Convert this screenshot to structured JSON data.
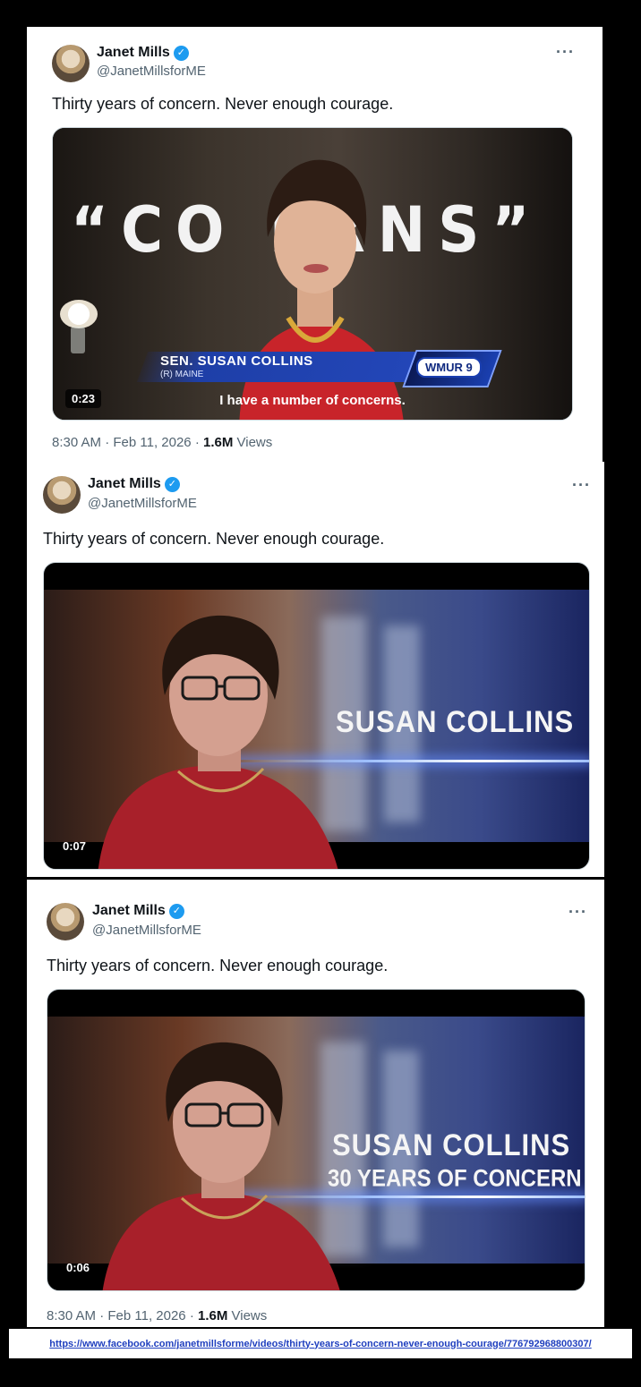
{
  "tweets": [
    {
      "author": "Janet Mills",
      "handle": "@JanetMillsforME",
      "text": "Thirty years of concern. Never enough courage.",
      "video": {
        "duration": "0:23",
        "overlay_word": "“CO   ERNS”",
        "lower_third_name": "SEN. SUSAN COLLINS",
        "lower_third_sub": "(R) MAINE",
        "station_logo": "WMUR 9",
        "caption": "I have a number of concerns."
      },
      "meta": {
        "time_date": "8:30 AM · Feb 11, 2026 · ",
        "views_count": "1.6M",
        "views_label": " Views"
      }
    },
    {
      "author": "Janet Mills",
      "handle": "@JanetMillsforME",
      "text": "Thirty years of concern. Never enough courage.",
      "video": {
        "duration": "0:07",
        "overlay_name": "SUSAN COLLINS"
      }
    },
    {
      "author": "Janet Mills",
      "handle": "@JanetMillsforME",
      "text": "Thirty years of concern. Never enough courage.",
      "video": {
        "duration": "0:06",
        "overlay_name": "SUSAN COLLINS",
        "overlay_sub": "30 YEARS OF CONCERN"
      },
      "meta": {
        "time_date": "8:30 AM · Feb 11, 2026 · ",
        "views_count": "1.6M",
        "views_label": " Views"
      }
    }
  ],
  "icons": {
    "verified": "verified-badge-icon",
    "more": "more-icon"
  },
  "more_glyph": "···",
  "verified_glyph": "✓",
  "source_url": "https://www.facebook.com/janetmillsforme/videos/thirty-years-of-concern-never-enough-courage/776792968800307/",
  "colors": {
    "verified": "#1d9bf0",
    "text": "#0f1419",
    "muted": "#536471",
    "link": "#1f3fbf"
  }
}
